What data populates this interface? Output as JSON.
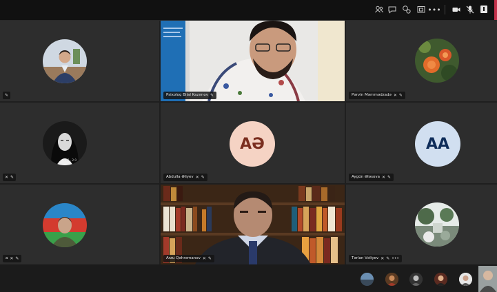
{
  "toolbar": {
    "icons": [
      "people-icon",
      "chat-icon",
      "reactions-icon",
      "rooms-icon",
      "more-icon",
      "camera-icon",
      "mic-off-icon",
      "share-icon"
    ],
    "more_label": "•••"
  },
  "tiles": [
    {
      "id": "t1",
      "name": "",
      "has_pin": true
    },
    {
      "id": "t2",
      "name": "Psixoloq Bilal Kazımov",
      "has_pin": true
    },
    {
      "id": "t3",
      "name": "Pərvin Məmmədzadə",
      "has_mic_off": true,
      "has_pin": true
    },
    {
      "id": "t4",
      "name": "",
      "has_mic_off": true,
      "has_pin": true,
      "caption": "• 01 , 2 0"
    },
    {
      "id": "t5",
      "name": "Abdulla Əliyev",
      "initials": "AƏ",
      "initials_bg": "#f5d3c4",
      "initials_color": "#7a2e1f",
      "has_mic_off": true,
      "has_pin": true
    },
    {
      "id": "t6",
      "name": "Aygün Ələsova",
      "initials": "AA",
      "initials_bg": "#d1dff0",
      "initials_color": "#0f2d5a",
      "has_mic_off": true,
      "has_pin": true
    },
    {
      "id": "t7",
      "name": "a",
      "has_mic_off": true,
      "has_pin": true
    },
    {
      "id": "t8",
      "name": "Arzu Qəhrəmanov",
      "has_mic_off": true,
      "has_pin": true
    },
    {
      "id": "t9",
      "name": "Tərlan Vəliyev",
      "has_mic_off": true,
      "has_pin": true,
      "has_more": true
    }
  ],
  "colors": {
    "accent": "#c4314b",
    "tile_bg": "#2d2d2d"
  }
}
